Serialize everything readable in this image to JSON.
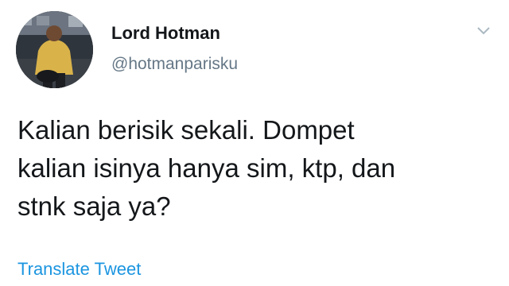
{
  "tweet": {
    "author": {
      "name": "Lord Hotman",
      "handle": "@hotmanparisku",
      "avatar_icon": "profile-photo"
    },
    "menu_icon": "chevron-down-icon",
    "text_lines": [
      "Kalian berisik sekali. Dompet",
      "kalian isinya hanya sim, ktp, dan",
      "stnk saja ya?"
    ],
    "translate_label": "Translate Tweet"
  },
  "colors": {
    "name": "#14171a",
    "handle": "#657786",
    "link": "#1b95e0",
    "background": "#ffffff"
  }
}
